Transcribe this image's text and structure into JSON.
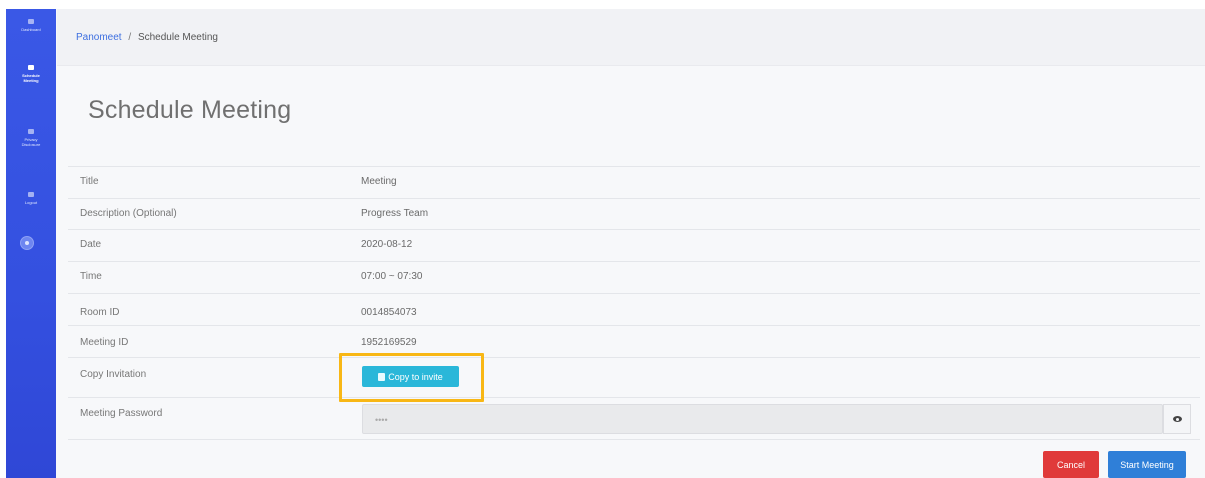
{
  "sidebar": {
    "items": [
      {
        "label": "Dashboard",
        "label2": ""
      },
      {
        "label": "Schedule",
        "label2": "Meeting"
      },
      {
        "label": "Privacy",
        "label2": "Disclosure"
      },
      {
        "label": "Logout",
        "label2": ""
      }
    ]
  },
  "breadcrumb": {
    "root": "Panomeet",
    "separator": "/",
    "current": "Schedule Meeting"
  },
  "page": {
    "title": "Schedule Meeting"
  },
  "details": {
    "title_label": "Title",
    "title_value": "Meeting",
    "description_label": "Description (Optional)",
    "description_value": "Progress Team",
    "date_label": "Date",
    "date_value": "2020-08-12",
    "time_label": "Time",
    "time_value": "07:00 ~ 07:30",
    "room_label": "Room ID",
    "room_value": "0014854073",
    "meeting_label": "Meeting ID",
    "meeting_value": "1952169529",
    "invitation_label": "Copy Invitation",
    "copy_button": "Copy to invite",
    "password_label": "Meeting Password",
    "password_value": "••••"
  },
  "actions": {
    "cancel": "Cancel",
    "start": "Start Meeting"
  },
  "colors": {
    "sidebar": "#3450e0",
    "copy_button": "#2ab7d9",
    "highlight": "#f8b715",
    "cancel": "#e03a3a",
    "start": "#2f7fd8"
  },
  "icons": {
    "copy": "copy-icon",
    "eye": "eye-icon"
  }
}
